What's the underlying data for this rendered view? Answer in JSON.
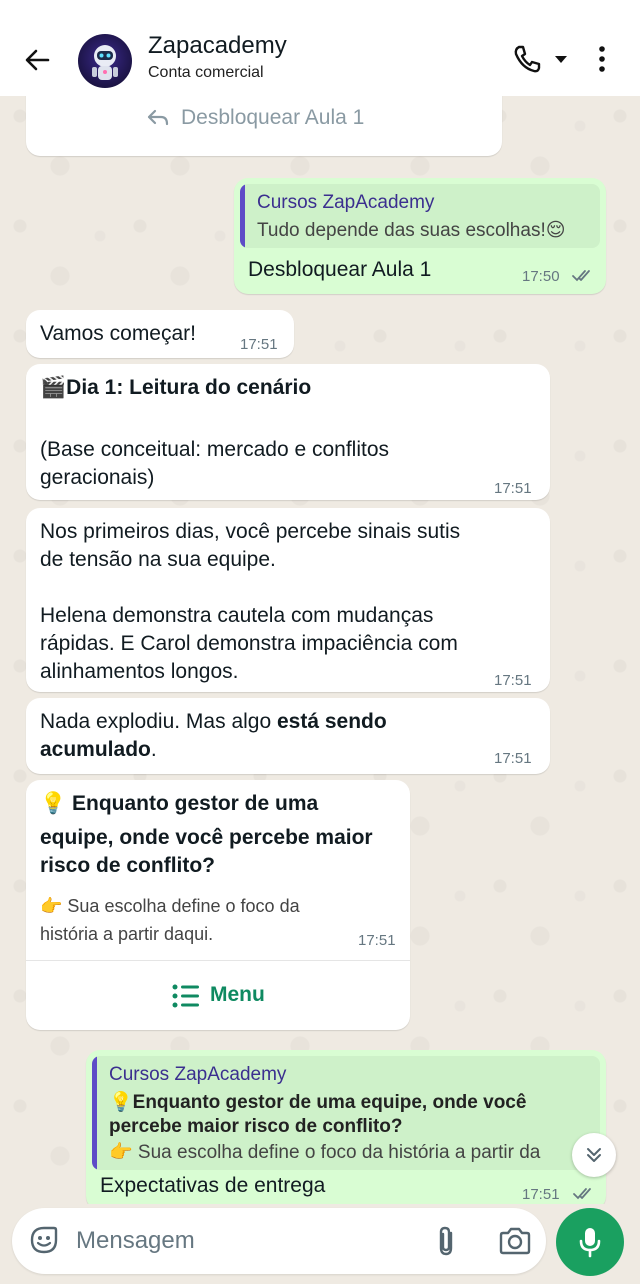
{
  "header": {
    "contact_name": "Zapacademy",
    "contact_subtitle": "Conta comercial"
  },
  "messages": {
    "top_button": {
      "label": "Desbloquear Aula 1"
    },
    "reply1": {
      "quote_author": "Cursos ZapAcademy",
      "quote_text": "Tudo depende das suas escolhas!😌",
      "text": "Desbloquear Aula 1",
      "time": "17:50"
    },
    "msg1": {
      "text": "Vamos começar!",
      "time": "17:51"
    },
    "msg2": {
      "title": "🎬Dia 1: Leitura do cenário",
      "line1": "(Base conceitual: mercado e conflitos",
      "line2": "geracionais)",
      "time": "17:51"
    },
    "msg3": {
      "line1": "Nos primeiros dias, você percebe sinais sutis",
      "line2": "de tensão na sua equipe.",
      "line3": "Helena demonstra cautela com mudanças",
      "line4": "rápidas. E Carol demonstra impaciência com",
      "line5": "alinhamentos longos.",
      "time": "17:51"
    },
    "msg4": {
      "text_plain": "Nada explodiu. Mas algo ",
      "text_bold1": "está sendo",
      "text_bold2": "acumulado",
      "text_end": ".",
      "time": "17:51"
    },
    "msg5": {
      "q_line1": "💡 Enquanto gestor de uma",
      "q_line2": "equipe, onde você percebe maior",
      "q_line3": "risco de conflito?",
      "hint_line1": "👉 Sua escolha define o foco da",
      "hint_line2": "história a partir daqui.",
      "time": "17:51",
      "menu_label": "Menu"
    },
    "reply2": {
      "quote_author": "Cursos ZapAcademy",
      "quote_line1": "💡Enquanto gestor de uma equipe, onde você",
      "quote_line2": "percebe maior risco de conflito?",
      "quote_line3": "👉 Sua escolha define o foco da história a partir da",
      "text": "Expectativas de entrega",
      "time": "17:51"
    }
  },
  "input": {
    "placeholder": "Mensagem"
  },
  "colors": {
    "accent": "#1aa060",
    "outgoing_bubble": "#d9fdd3",
    "chat_bg": "#efeae2",
    "quote_bar": "#5e4bc7"
  }
}
